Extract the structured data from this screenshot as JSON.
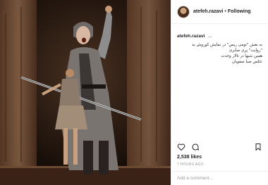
{
  "post": {
    "username": "atefeh.razavi",
    "separator": "•",
    "follow_state": "Following"
  },
  "caption": {
    "username": "atefeh.razavi",
    "more": "...",
    "lines": [
      "به نقش \"تومی ریس\" در نمایش کوروش به",
      "\"روایت\" پری صابری",
      "همین شبها در تالار وحدت",
      "عکس صبا صفویان"
    ]
  },
  "actions": {
    "like_icon": "heart-icon",
    "comment_icon": "comment-icon",
    "save_icon": "bookmark-icon"
  },
  "stats": {
    "likes": "2,538 likes",
    "time": "7 HOURS AGO"
  },
  "comment_box": {
    "placeholder": "Add a comment..."
  }
}
